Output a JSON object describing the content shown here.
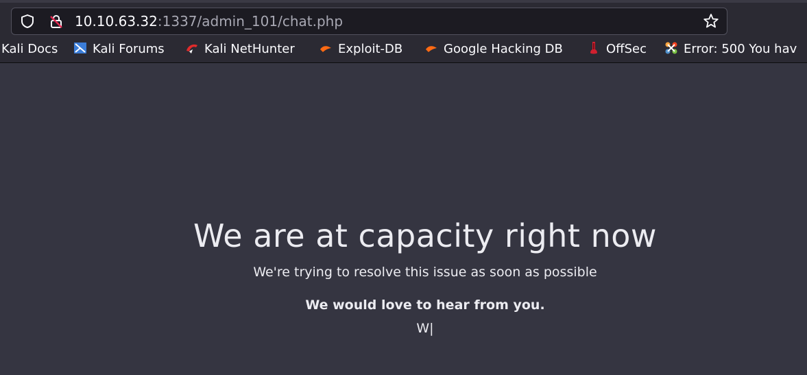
{
  "address_bar": {
    "url_host": "10.10.63.32",
    "url_rest": ":1337/admin_101/chat.php"
  },
  "bookmarks": [
    {
      "label": "Kali Docs",
      "icon": "kali-docs-icon"
    },
    {
      "label": "Kali Forums",
      "icon": "kali-forums-icon"
    },
    {
      "label": "Kali NetHunter",
      "icon": "kali-nethunter-icon"
    },
    {
      "label": "Exploit-DB",
      "icon": "exploit-db-icon"
    },
    {
      "label": "Google Hacking DB",
      "icon": "google-hacking-db-icon"
    },
    {
      "label": "OffSec",
      "icon": "offsec-icon"
    },
    {
      "label": "Error: 500 You hav",
      "icon": "joomla-icon"
    }
  ],
  "page": {
    "headline": "We are at capacity right now",
    "subline": "We're trying to resolve this issue as soon as possible",
    "bold_line": "We would love to hear from you.",
    "typing_text": "W|"
  },
  "colors": {
    "page_background": "#353541",
    "toolbar_background": "#2b2a33",
    "text": "#ececf1"
  }
}
